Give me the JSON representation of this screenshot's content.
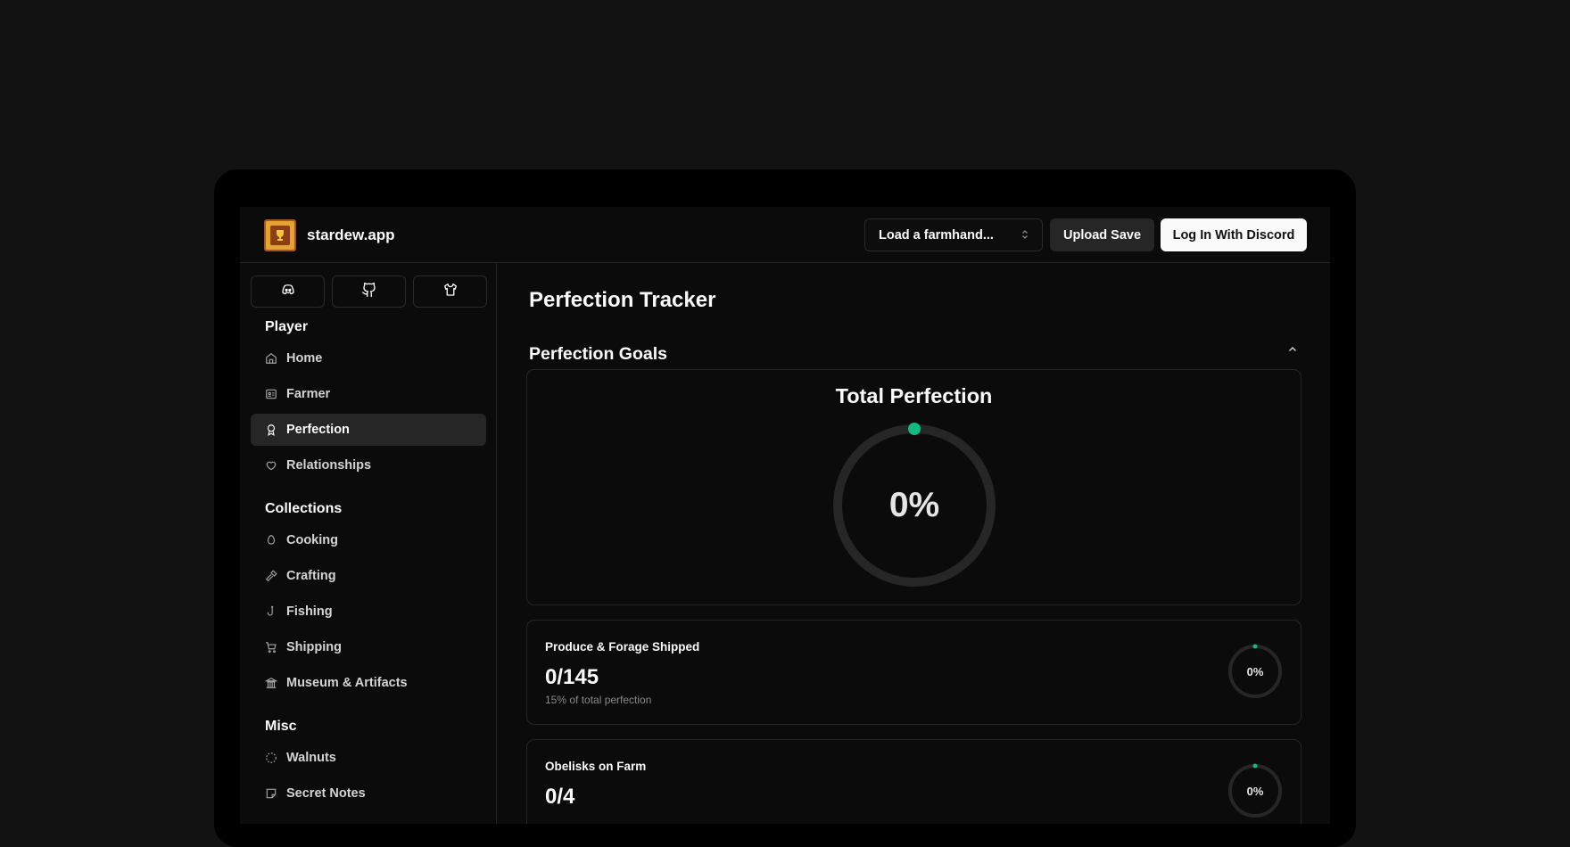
{
  "header": {
    "brand": "stardew.app",
    "farmhand_select": "Load a farmhand...",
    "upload_button": "Upload Save",
    "login_button": "Log In With Discord"
  },
  "sidebar": {
    "social": [
      {
        "icon": "discord-icon"
      },
      {
        "icon": "github-icon"
      },
      {
        "icon": "shirt-icon"
      }
    ],
    "sections": [
      {
        "title": "Player",
        "items": [
          {
            "label": "Home",
            "icon": "home-icon"
          },
          {
            "label": "Farmer",
            "icon": "id-card-icon"
          },
          {
            "label": "Perfection",
            "icon": "award-icon",
            "active": true
          },
          {
            "label": "Relationships",
            "icon": "heart-icon"
          }
        ]
      },
      {
        "title": "Collections",
        "items": [
          {
            "label": "Cooking",
            "icon": "egg-icon"
          },
          {
            "label": "Crafting",
            "icon": "hammer-icon"
          },
          {
            "label": "Fishing",
            "icon": "hook-icon"
          },
          {
            "label": "Shipping",
            "icon": "cart-icon"
          },
          {
            "label": "Museum & Artifacts",
            "icon": "museum-icon"
          }
        ]
      },
      {
        "title": "Misc",
        "items": [
          {
            "label": "Walnuts",
            "icon": "loader-circle-icon"
          },
          {
            "label": "Secret Notes",
            "icon": "sticky-note-icon"
          }
        ]
      }
    ]
  },
  "main": {
    "title": "Perfection Tracker",
    "goals_title": "Perfection Goals",
    "total": {
      "title": "Total Perfection",
      "percent_text": "0%",
      "percent": 0
    },
    "goals": [
      {
        "label": "Produce & Forage Shipped",
        "value": "0/145",
        "sub": "15% of total perfection",
        "percent_text": "0%",
        "percent": 0
      },
      {
        "label": "Obelisks on Farm",
        "value": "0/4",
        "sub": "",
        "percent_text": "0%",
        "percent": 0
      }
    ]
  },
  "colors": {
    "accent": "#10b981",
    "ring_track": "#262626"
  }
}
